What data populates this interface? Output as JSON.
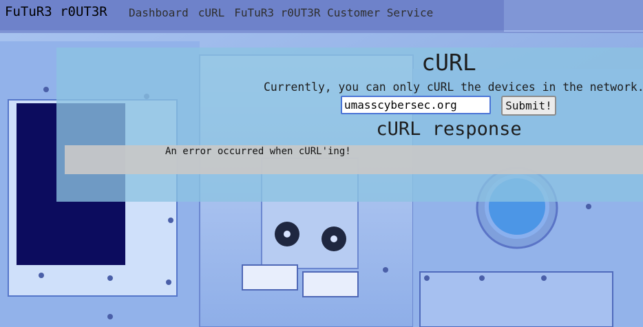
{
  "navbar": {
    "brand": "FuTuR3 r0UT3R",
    "links": [
      "Dashboard",
      "cURL",
      "FuTuR3 r0UT3R Customer Service"
    ]
  },
  "curl": {
    "title": "cURL",
    "description": "Currently, you can only cURL the devices in the network.",
    "url_value": "umasscybersec.org",
    "submit_label": "Submit!",
    "response_title": "cURL response",
    "response_text": "An error occurred when cURL'ing!"
  },
  "colors": {
    "panel": "#8cc3e1",
    "navbar": "#5a6ebe",
    "input_border": "#4a74d6"
  },
  "icons": [
    "fan-icon",
    "porthole-icon"
  ]
}
